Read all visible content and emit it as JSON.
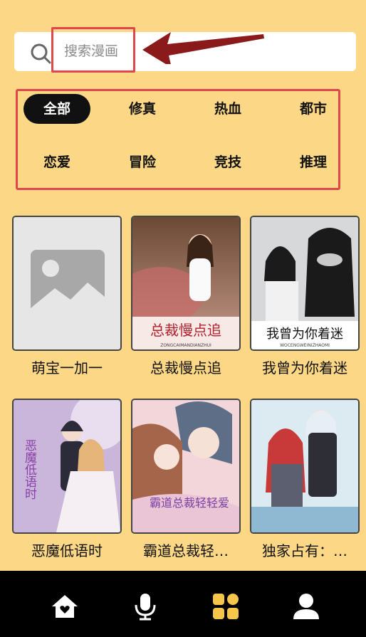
{
  "search": {
    "placeholder": "搜索漫画",
    "icon": "search-icon"
  },
  "annotation": {
    "highlight_color": "#E0474C",
    "arrow_color": "#8B1A1A"
  },
  "categories": [
    {
      "label": "全部",
      "active": true
    },
    {
      "label": "修真",
      "active": false
    },
    {
      "label": "热血",
      "active": false
    },
    {
      "label": "都市",
      "active": false
    },
    {
      "label": "恋爱",
      "active": false
    },
    {
      "label": "冒险",
      "active": false
    },
    {
      "label": "竞技",
      "active": false
    },
    {
      "label": "推理",
      "active": false
    }
  ],
  "comics": [
    {
      "title": "萌宝一加一",
      "cover_text": ""
    },
    {
      "title": "总裁慢点追",
      "cover_text": "总裁慢点追",
      "cover_subtext": "ZONGCAIMANDIANZHUI"
    },
    {
      "title": "我曾为你着迷",
      "cover_text": "我曾为你着迷",
      "cover_subtext": "WOCENGWEINIZHAOMI"
    },
    {
      "title": "恶魔低语时",
      "cover_text": "恶魔低语时"
    },
    {
      "title": "霸道总裁轻…",
      "cover_text": "霸道总裁轻轻爱"
    },
    {
      "title": "独家占有：…",
      "cover_text": ""
    }
  ],
  "bottom_nav": [
    {
      "icon": "home-icon",
      "active": false
    },
    {
      "icon": "microphone-icon",
      "active": false
    },
    {
      "icon": "grid-icon",
      "active": true
    },
    {
      "icon": "user-icon",
      "active": false
    }
  ],
  "colors": {
    "background": "#FCD886",
    "nav_bg": "#000000",
    "active_nav": "#F5C64A",
    "active_chip": "#111111"
  }
}
